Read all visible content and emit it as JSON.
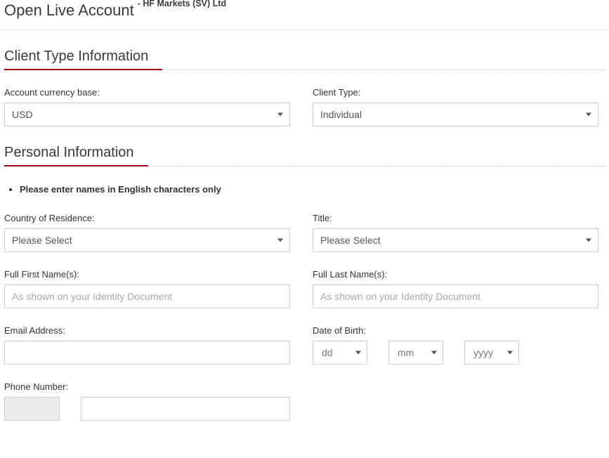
{
  "header": {
    "title": "Open Live Account",
    "title_suffix": "- HF Markets (SV) Ltd"
  },
  "accent_color": "#A00A14",
  "sections": {
    "client_type": {
      "title": "Client Type Information",
      "fields": {
        "account_currency": {
          "label": "Account currency base:",
          "value": "USD"
        },
        "client_type": {
          "label": "Client Type:",
          "value": "Individual"
        }
      }
    },
    "personal": {
      "title": "Personal Information",
      "notes": [
        "Please enter names in English characters only"
      ],
      "fields": {
        "country_of_residence": {
          "label": "Country of Residence:",
          "value": "Please Select"
        },
        "title": {
          "label": "Title:",
          "value": "Please Select"
        },
        "first_name": {
          "label": "Full First Name(s):",
          "value": "",
          "placeholder": "As shown on your Identity Document"
        },
        "last_name": {
          "label": "Full Last Name(s):",
          "value": "",
          "placeholder": "As shown on your Identity Document"
        },
        "email": {
          "label": "Email Address:",
          "value": "",
          "placeholder": ""
        },
        "date_of_birth": {
          "label": "Date of Birth:",
          "day": "dd",
          "month": "mm",
          "year": "yyyy"
        },
        "phone": {
          "label": "Phone Number:",
          "country_code": "",
          "number": "",
          "placeholder": ""
        }
      }
    }
  }
}
